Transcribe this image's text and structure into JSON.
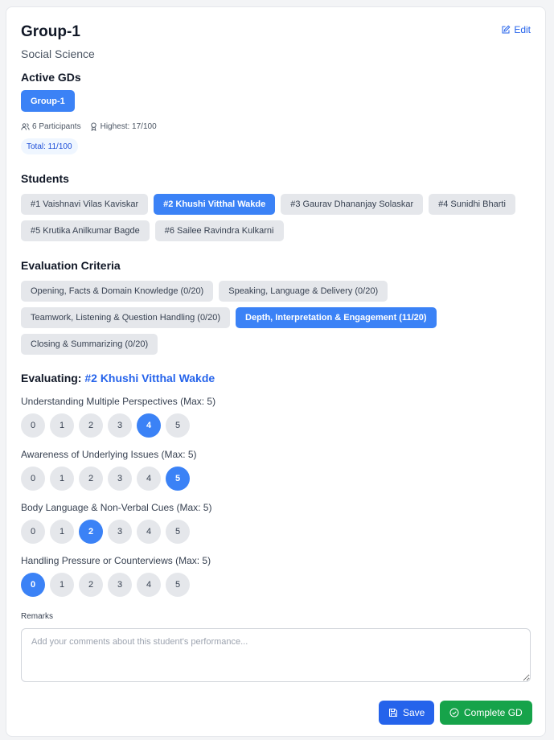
{
  "header": {
    "title": "Group-1",
    "subtitle": "Social Science",
    "edit_label": "Edit"
  },
  "active_gds": {
    "heading": "Active GDs",
    "items": [
      "Group-1"
    ]
  },
  "meta": {
    "participants": "6 Participants",
    "highest": "Highest: 17/100",
    "total": "Total: 11/100"
  },
  "students": {
    "heading": "Students",
    "items": [
      {
        "label": "#1  Vaishnavi Vilas Kaviskar",
        "active": false
      },
      {
        "label": "#2  Khushi Vitthal Wakde",
        "active": true
      },
      {
        "label": "#3  Gaurav Dhananjay Solaskar",
        "active": false
      },
      {
        "label": "#4  Sunidhi Bharti",
        "active": false
      },
      {
        "label": "#5  Krutika Anilkumar Bagde",
        "active": false
      },
      {
        "label": "#6  Sailee Ravindra Kulkarni",
        "active": false
      }
    ]
  },
  "criteria": {
    "heading": "Evaluation Criteria",
    "items": [
      {
        "label": "Opening, Facts & Domain Knowledge (0/20)",
        "active": false
      },
      {
        "label": "Speaking, Language & Delivery (0/20)",
        "active": false
      },
      {
        "label": "Teamwork, Listening & Question Handling (0/20)",
        "active": false
      },
      {
        "label": "Depth, Interpretation & Engagement (11/20)",
        "active": true
      },
      {
        "label": "Closing & Summarizing (0/20)",
        "active": false
      }
    ]
  },
  "evaluating": {
    "prefix": "Evaluating:",
    "student": "#2 Khushi Vitthal Wakde"
  },
  "questions": [
    {
      "label": "Understanding Multiple Perspectives (Max: 5)",
      "selected": 4
    },
    {
      "label": "Awareness of Underlying Issues (Max: 5)",
      "selected": 5
    },
    {
      "label": "Body Language & Non-Verbal Cues (Max: 5)",
      "selected": 2
    },
    {
      "label": "Handling Pressure or Counterviews (Max: 5)",
      "selected": 0
    }
  ],
  "score_options": [
    "0",
    "1",
    "2",
    "3",
    "4",
    "5"
  ],
  "remarks": {
    "label": "Remarks",
    "placeholder": "Add your comments about this student's performance...",
    "value": ""
  },
  "actions": {
    "save_label": "Save",
    "complete_label": "Complete GD"
  },
  "colors": {
    "primary": "#3b82f6",
    "save": "#2563eb",
    "complete": "#16a34a",
    "chip": "#e5e7eb"
  }
}
